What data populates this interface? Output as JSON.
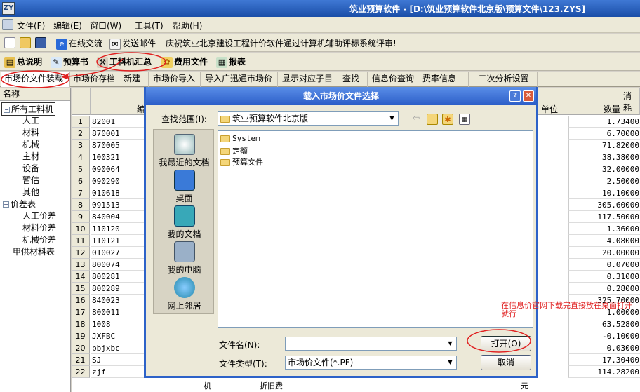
{
  "app": {
    "title": "筑业预算软件 - [D:\\筑业预算软件北京版\\预算文件\\123.ZYS]"
  },
  "menu": [
    "文件(F)",
    "编辑(E)",
    "窗口(W)",
    "工具(T)",
    "帮助(H)"
  ],
  "toolbar1": {
    "online": "在线交流",
    "mail": "发送邮件",
    "notice": "庆祝筑业北京建设工程计价软件通过计算机辅助评标系统评审!"
  },
  "toolbar2": {
    "summary": "总说明",
    "budget": "预算书",
    "material": "工料机汇总",
    "cost": "费用文件",
    "report": "报表"
  },
  "tabs": [
    "市场价文件装载",
    "市场价存档",
    "新建",
    "市场价导入",
    "导入广迅通市场价",
    "显示对应子目",
    "查找",
    "信息价查询",
    "费率信息",
    "二次分析设置"
  ],
  "tree": {
    "header": "名称",
    "items": [
      "所有工料机",
      "人工",
      "材料",
      "机械",
      "主材",
      "设备",
      "暂估",
      "其他",
      "价差表",
      "人工价差",
      "材料价差",
      "机械价差",
      "甲供材料表"
    ]
  },
  "grid": {
    "col_code": "编",
    "col_unit": "单位",
    "col_qty_group": "消耗",
    "col_qty": "数量",
    "rows": [
      {
        "n": "1",
        "code": "82001",
        "qty": "1.73400"
      },
      {
        "n": "2",
        "code": "870001",
        "qty": "6.70000"
      },
      {
        "n": "3",
        "code": "870005",
        "qty": "71.82000"
      },
      {
        "n": "4",
        "code": "100321",
        "qty": "38.38000"
      },
      {
        "n": "5",
        "code": "090064",
        "qty": "32.00000"
      },
      {
        "n": "6",
        "code": "090290",
        "qty": "2.50000"
      },
      {
        "n": "7",
        "code": "010618",
        "qty": "10.10000"
      },
      {
        "n": "8",
        "code": "091513",
        "qty": "305.60000"
      },
      {
        "n": "9",
        "code": "840004",
        "qty": "117.50000"
      },
      {
        "n": "10",
        "code": "110120",
        "qty": "1.36000"
      },
      {
        "n": "11",
        "code": "110121",
        "qty": "4.08000"
      },
      {
        "n": "12",
        "code": "010027",
        "qty": "20.00000"
      },
      {
        "n": "13",
        "code": "800074",
        "qty": "0.07000"
      },
      {
        "n": "14",
        "code": "800281",
        "qty": "0.31000"
      },
      {
        "n": "15",
        "code": "800289",
        "qty": "0.28000"
      },
      {
        "n": "16",
        "code": "840023",
        "qty": "325.70000"
      },
      {
        "n": "17",
        "code": "800011",
        "qty": "1.00000"
      },
      {
        "n": "18",
        "code": "1008",
        "qty": "63.52800"
      },
      {
        "n": "19",
        "code": "JXFBC",
        "qty": "-0.10000"
      },
      {
        "n": "20",
        "code": "pbjxbc",
        "qty": "0.03000"
      },
      {
        "n": "21",
        "code": "SJ",
        "qty": "17.30400"
      },
      {
        "n": "22",
        "code": "zjf",
        "qty": "114.28200"
      }
    ],
    "row22": {
      "type": "机",
      "name": "折旧费",
      "unit": "元"
    }
  },
  "dialog": {
    "title": "载入市场价文件选择",
    "lookin_label": "查找范围(I):",
    "lookin_value": "筑业预算软件北京版",
    "places": [
      "我最近的文档",
      "桌面",
      "我的文档",
      "我的电脑",
      "网上邻居"
    ],
    "files": [
      "System",
      "定额",
      "预算文件"
    ],
    "filename_label": "文件名(N):",
    "filename_value": "",
    "filetype_label": "文件类型(T):",
    "filetype_value": "市场价文件(*.PF)",
    "open": "打开(O)",
    "cancel": "取消"
  },
  "annotation": "在信息价官网下载完直接放在桌面打开就行"
}
